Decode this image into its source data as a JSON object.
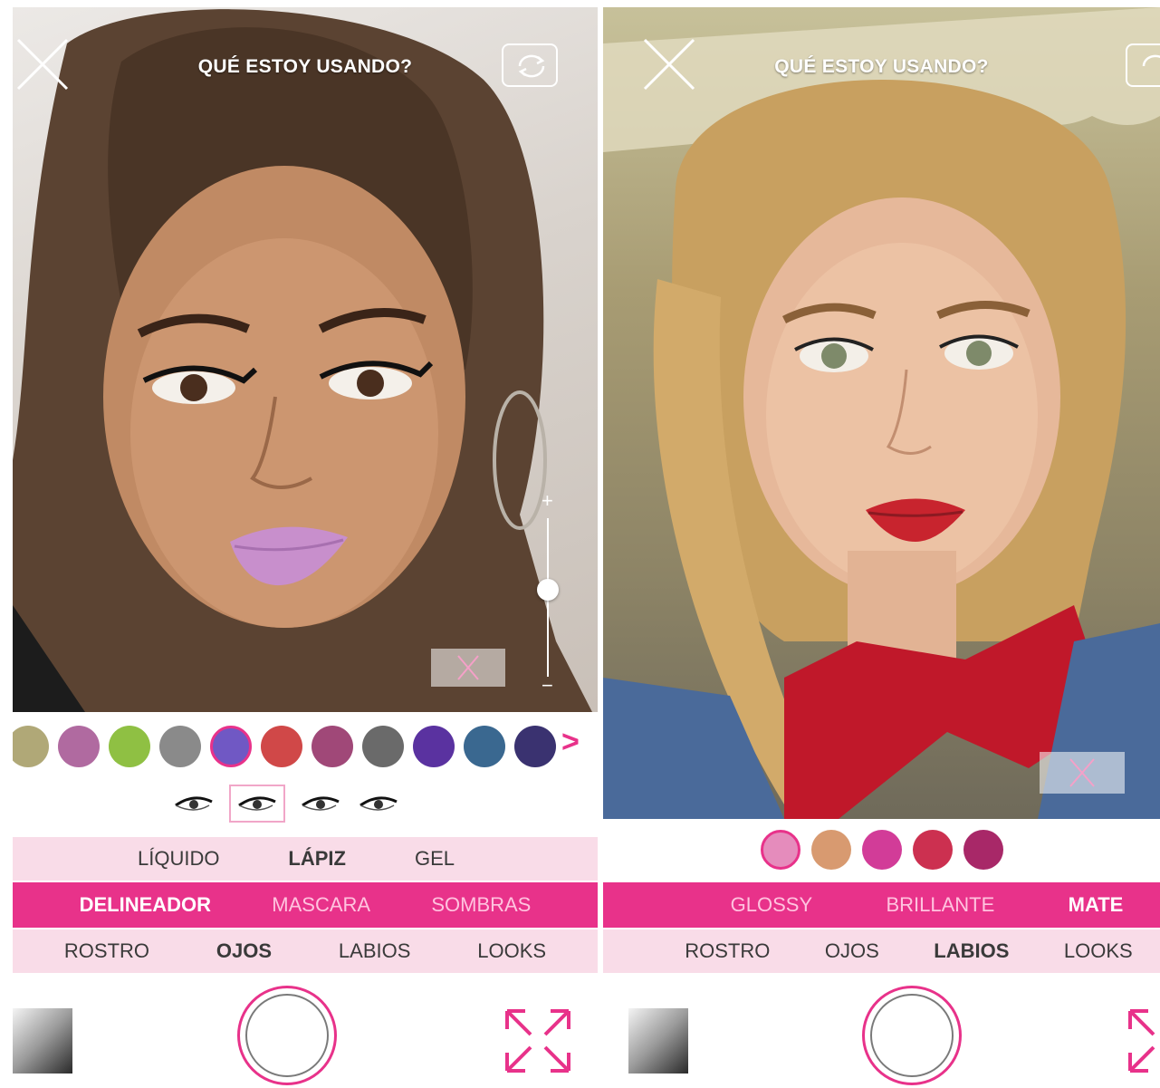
{
  "colors": {
    "accent_pink": "#e8328a",
    "light_pink": "#f9dce8",
    "inactive_pink_text": "#ffc3df"
  },
  "screen1": {
    "title": "QUÉ ESTOY USANDO?",
    "icons": [
      "close-icon",
      "camera-switch-icon",
      "intensity-slider",
      "compare-icon",
      "gallery-icon",
      "shutter-icon",
      "expand-icon"
    ],
    "swatches": [
      "#b0a877",
      "#b06aa0",
      "#8fc043",
      "#8a8a8a",
      "#7058c4",
      "#d04848",
      "#a04878",
      "#6a6a6a",
      "#5a32a0",
      "#3a6890",
      "#3a3270"
    ],
    "selected_swatch_index": 4,
    "more_arrow": ">",
    "eyeliner_styles_count": 4,
    "selected_eyeliner_index": 1,
    "intensity_level": 0.55,
    "intensity_plus": "+",
    "intensity_minus": "−",
    "finish_tabs": [
      "LÍQUIDO",
      "LÁPIZ",
      "GEL"
    ],
    "active_finish": "LÁPIZ",
    "product_tabs": [
      "DELINEADOR",
      "MASCARA",
      "SOMBRAS"
    ],
    "active_product": "DELINEADOR",
    "category_tabs": [
      "ROSTRO",
      "OJOS",
      "LABIOS",
      "LOOKS"
    ],
    "active_category": "OJOS"
  },
  "screen2": {
    "title": "QUÉ ESTOY USANDO?",
    "icons": [
      "close-icon",
      "camera-switch-icon",
      "compare-icon",
      "gallery-icon",
      "shutter-icon",
      "expand-icon"
    ],
    "swatches": [
      "#e58cbc",
      "#d89a70",
      "#d23c98",
      "#cc3050",
      "#a82868"
    ],
    "selected_swatch_index": 0,
    "finish_tabs": [
      "GLOSSY",
      "BRILLANTE",
      "MATE"
    ],
    "active_finish": "MATE",
    "category_tabs": [
      "ROSTRO",
      "OJOS",
      "LABIOS",
      "LOOKS"
    ],
    "active_category": "LABIOS"
  }
}
